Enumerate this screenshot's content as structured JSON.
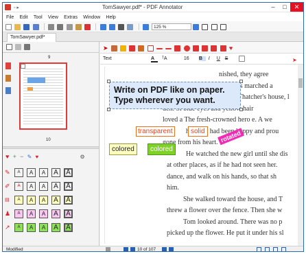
{
  "window": {
    "title": "TomSawyer.pdf* - PDF Annotator",
    "controls": {
      "minimize": "–",
      "maximize": "□",
      "close": "✕"
    }
  },
  "menu": [
    "File",
    "Edit",
    "Tool",
    "View",
    "Extras",
    "Window",
    "Help"
  ],
  "toolbar": {
    "zoom": "125 %"
  },
  "tab": {
    "label": "TomSawyer.pdf*"
  },
  "sidebar": {
    "thumb_page": "9",
    "thumb_page_next": "10"
  },
  "format_bar": {
    "font": "Text",
    "size": "16",
    "bold": "B",
    "italic": "I",
    "underline": "U",
    "strike": "S"
  },
  "document": {
    "callout": [
      "Write on PDF like on paper.",
      "Type wherever you want."
    ],
    "labels": {
      "transparent": "transparent",
      "solid": "solid",
      "rotated": "rotated",
      "colored1": "colored",
      "colored2": "colored"
    },
    "lines": [
      "nished, they agree",
      "armies marched a",
      "As he passed Jeff Thatcher's house, l",
      "den. Sl  blue eyes  and yellow hair",
      "loved a   The fresh-crowned hero  e. A we",
      "him. He had been happy and prou",
      "gone from his heart.",
      "He watched the new girl until she dis",
      "at other places, as if he had not seen her.",
      "dance, and walk on his hands, so that sh",
      "him.",
      "She walked toward the house, and T",
      "threw a flower over the fence. Then she w",
      "Tom looked around. There was no p",
      "picked up the flower. He put it under his sl"
    ]
  },
  "stamps": {
    "glyph": "A"
  },
  "status": {
    "left": "Modified",
    "page": "10 of 107"
  },
  "colors": {
    "accent": "#2b6cb0",
    "callout_bg": "#dbe9fb",
    "orange": "#e9731c",
    "green": "#7fd126",
    "magenta": "#f22bb6",
    "yellow_bg": "#ffffc0"
  }
}
